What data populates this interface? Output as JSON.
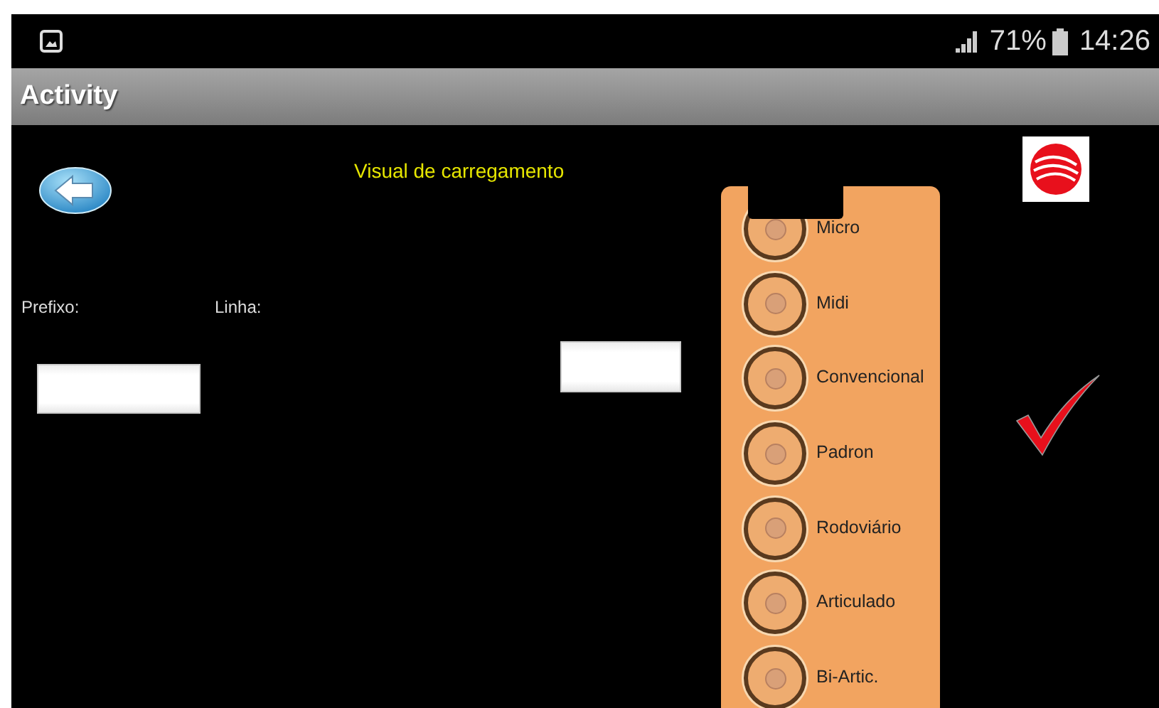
{
  "status_bar": {
    "battery": "71%",
    "time": "14:26"
  },
  "app_bar": {
    "title": "Activity"
  },
  "header": {
    "title": "Visual de carregamento"
  },
  "form": {
    "prefix_label": "Prefixo:",
    "line_label": "Linha:"
  },
  "vehicle_types": [
    {
      "label": "Micro",
      "selected": false
    },
    {
      "label": "Midi",
      "selected": false
    },
    {
      "label": "Convencional",
      "selected": false
    },
    {
      "label": "Padron",
      "selected": false
    },
    {
      "label": "Rodoviário",
      "selected": false
    },
    {
      "label": "Articulado",
      "selected": false
    },
    {
      "label": "Bi-Artic.",
      "selected": false
    }
  ]
}
